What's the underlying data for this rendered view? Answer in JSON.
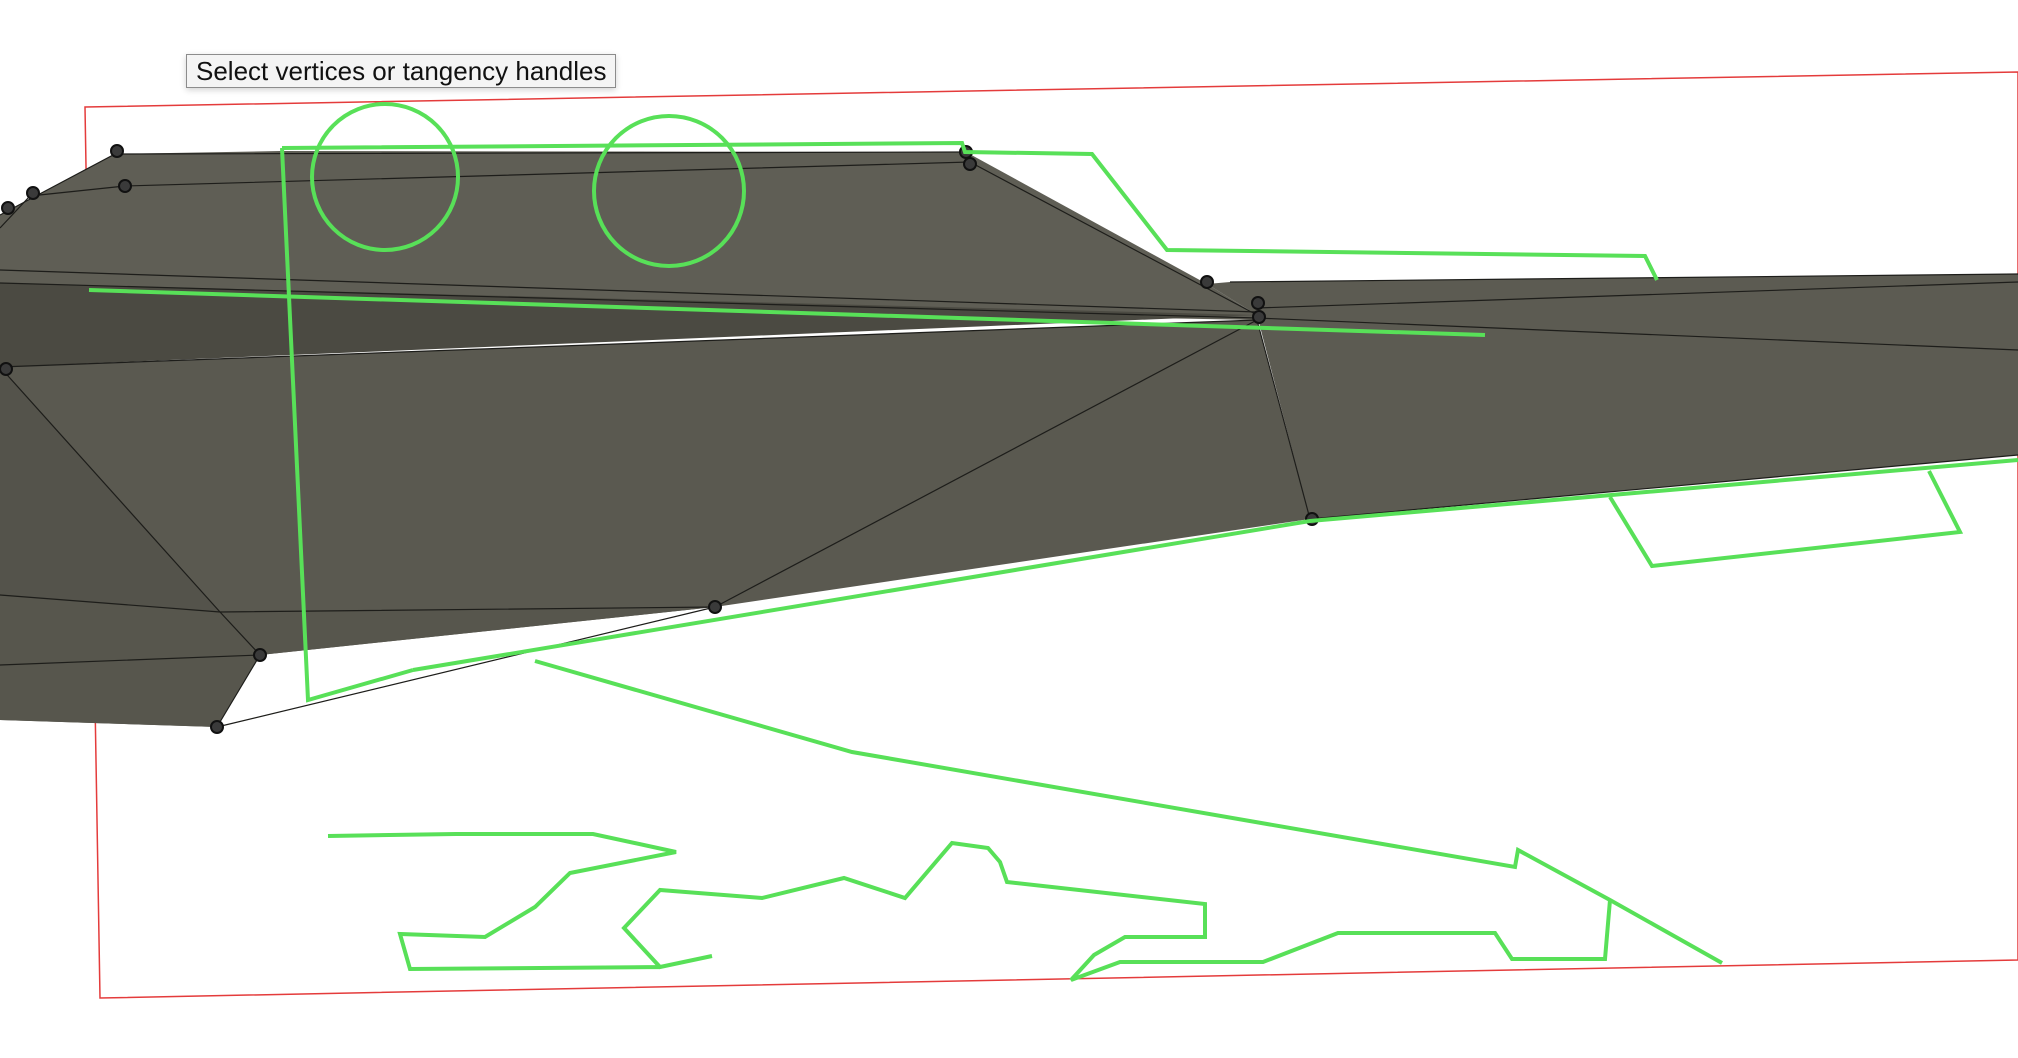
{
  "tooltip": {
    "text": "Select vertices or tangency handles"
  },
  "colors": {
    "background": "#ffffff",
    "mesh_fill": "#5f5e55",
    "mesh_dark": "#4b4a42",
    "mesh_edge": "#1d1d1a",
    "reference_outline": "#58e058",
    "crop_frame": "#e43b3b",
    "vertex_handle": "#3a3a3a"
  },
  "icons": {
    "vertex_handle": "vertex-handle-icon"
  }
}
